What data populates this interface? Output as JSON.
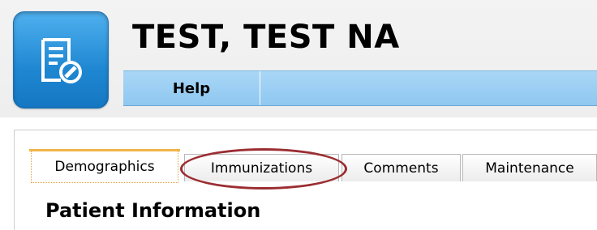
{
  "header": {
    "patient_name": "TEST, TEST NA",
    "app_icon": "document-edit-icon"
  },
  "menu": {
    "items": [
      {
        "label": "Help"
      }
    ]
  },
  "tabs": [
    {
      "label": "Demographics",
      "active": true
    },
    {
      "label": "Immunizations",
      "active": false,
      "highlighted": true
    },
    {
      "label": "Comments",
      "active": false
    },
    {
      "label": "Maintenance",
      "active": false
    }
  ],
  "content": {
    "section_title": "Patient Information"
  },
  "colors": {
    "menubar": "#a9d6f6",
    "app_icon": "#2a95de",
    "highlight_ring": "#9b2d32",
    "active_tab_accent": "#f1b548"
  }
}
